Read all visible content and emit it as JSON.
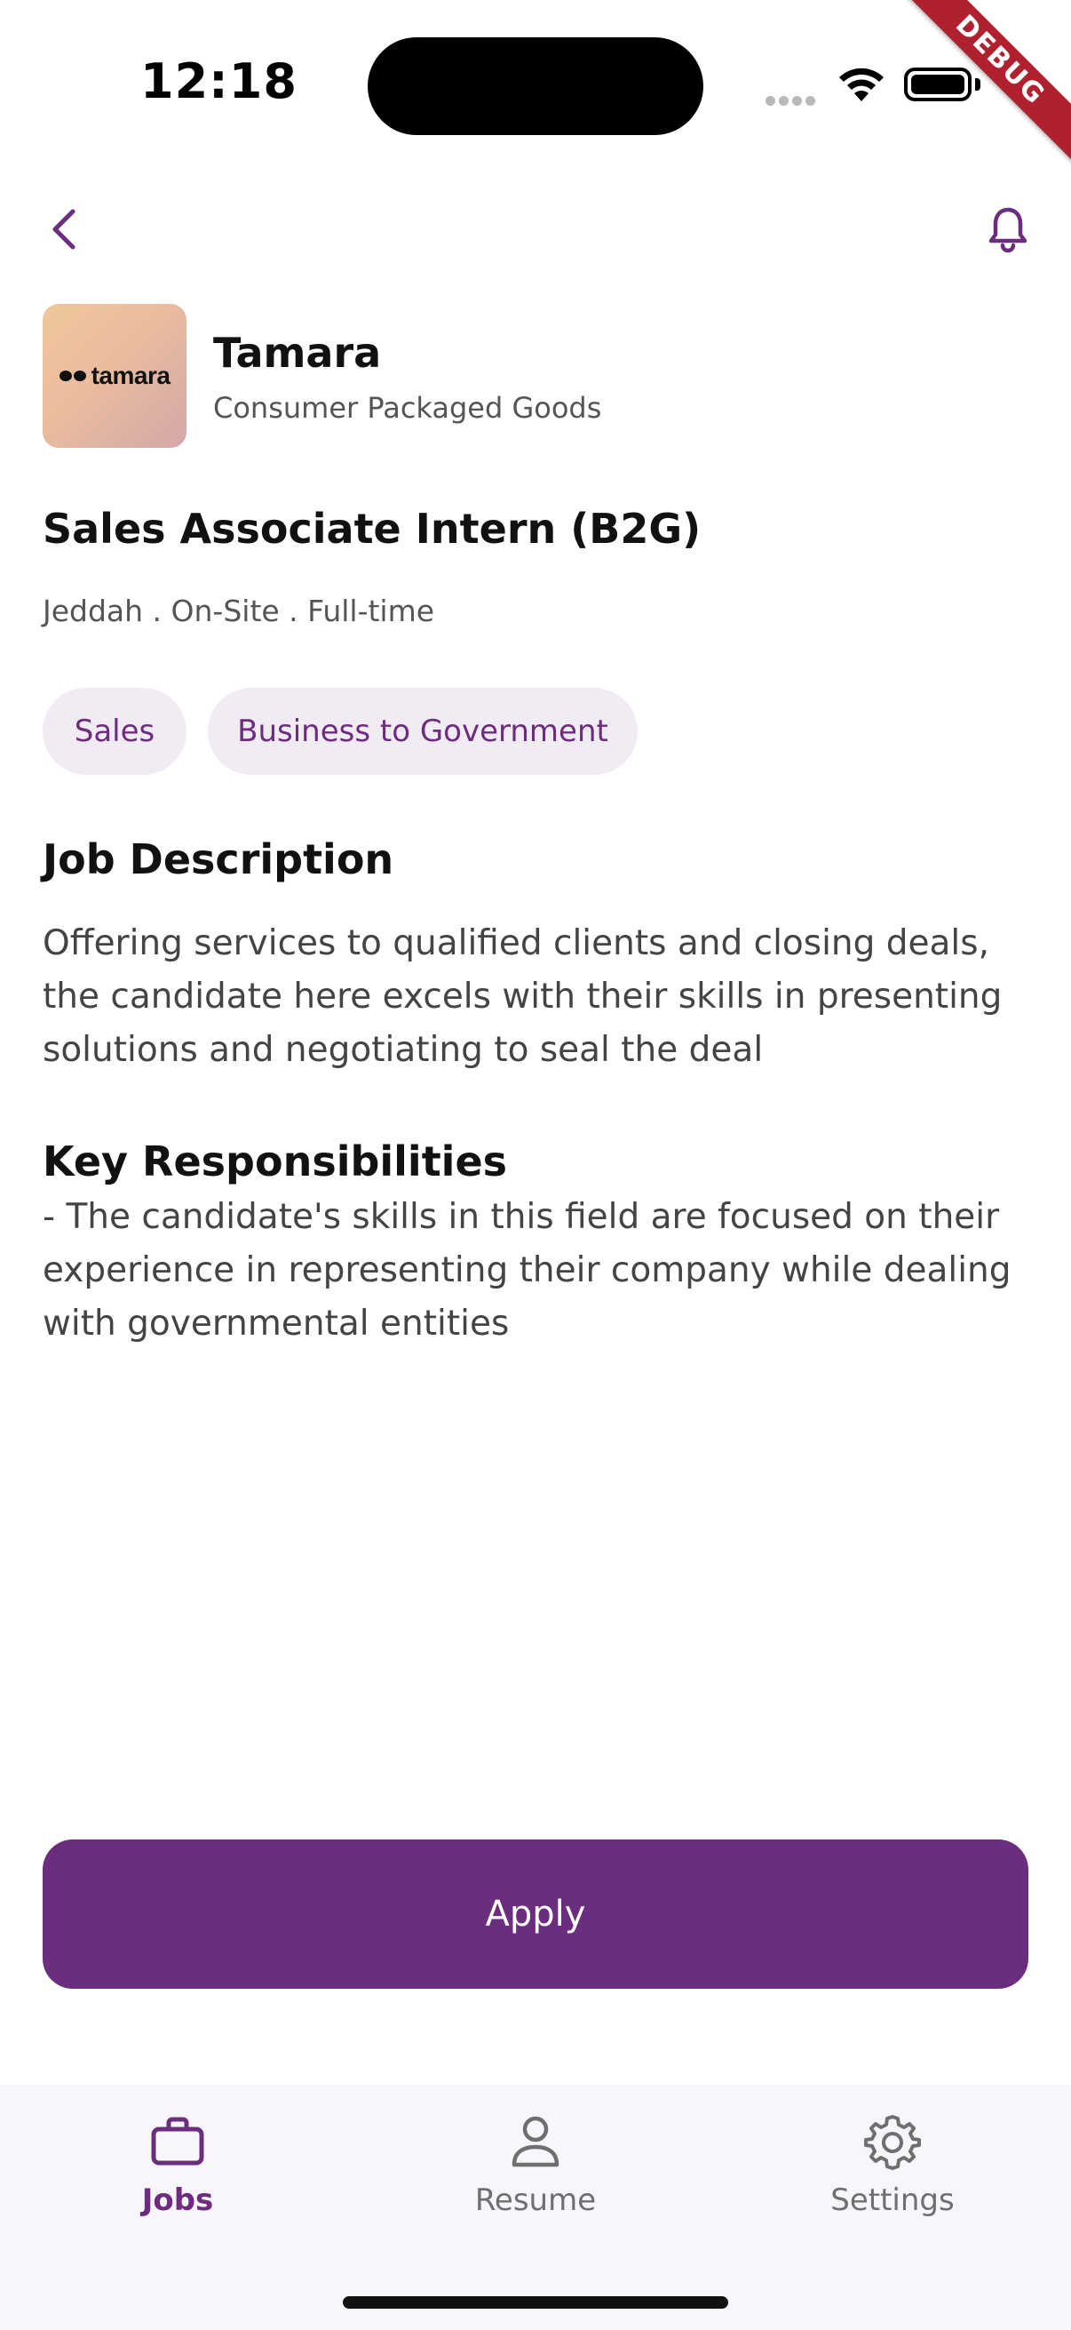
{
  "status_bar": {
    "time": "12:18",
    "debug_label": "DEBUG"
  },
  "icons": {
    "back": "chevron-left-icon",
    "notifications": "bell-icon",
    "jobs": "briefcase-icon",
    "resume": "person-icon",
    "settings": "gear-icon"
  },
  "company": {
    "name": "Tamara",
    "industry": "Consumer Packaged Goods",
    "logo_text": "tamara"
  },
  "job": {
    "title": "Sales Associate Intern (B2G)",
    "meta": "Jeddah . On-Site . Full-time",
    "tags": [
      "Sales",
      "Business to Government"
    ]
  },
  "sections": {
    "description_heading": "Job Description",
    "description_body": "Offering services to qualified clients and closing deals, the candidate here excels with their skills in presenting solutions and negotiating to seal the deal",
    "responsibilities_heading": "Key Responsibilities",
    "responsibilities_body": "- The candidate's skills in this field are focused on their experience in representing their company while dealing with governmental entities"
  },
  "actions": {
    "apply_label": "Apply"
  },
  "bottom_nav": {
    "items": [
      {
        "label": "Jobs",
        "active": true
      },
      {
        "label": "Resume",
        "active": false
      },
      {
        "label": "Settings",
        "active": false
      }
    ]
  },
  "colors": {
    "accent": "#6b2d7e",
    "tag_bg": "#f1ebf3",
    "nav_bg": "#f8f6fb",
    "debug_ribbon": "#b0202e"
  }
}
